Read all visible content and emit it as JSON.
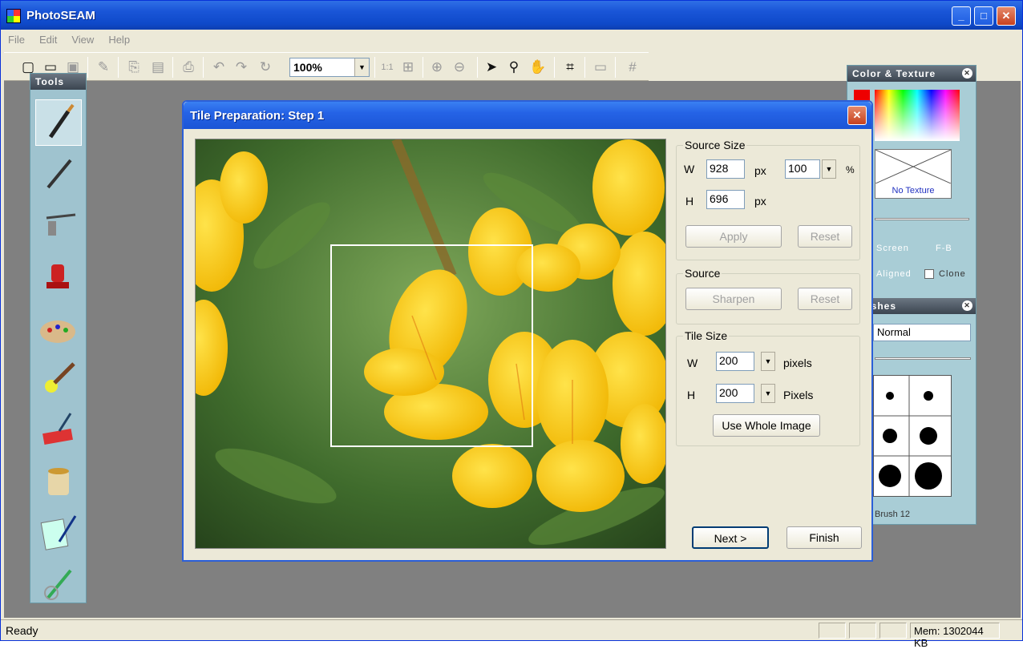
{
  "app": {
    "title": "PhotoSEAM"
  },
  "window_controls": {
    "minimize": "_",
    "maximize": "□",
    "close": "✕"
  },
  "menu": [
    {
      "label": "File"
    },
    {
      "label": "Edit"
    },
    {
      "label": "View"
    },
    {
      "label": "Help"
    }
  ],
  "toolbar": {
    "zoom_value": "100%",
    "actual_size": "1:1"
  },
  "tools_panel": {
    "title": "Tools"
  },
  "color_panel": {
    "title": "Color & Texture",
    "texture_label": "No Texture",
    "screen_label": "Screen",
    "fb_label": "F-B",
    "aligned_label": "Aligned",
    "clone_label": "Clone"
  },
  "brush_panel": {
    "title": "Brushes",
    "blend_mode": "Normal",
    "brush_name": "Brush 12"
  },
  "dialog": {
    "title": "Tile Preparation: Step 1",
    "source_size": {
      "legend": "Source Size",
      "w_label": "W",
      "w_value": "928",
      "w_unit": "px",
      "h_label": "H",
      "h_value": "696",
      "h_unit": "px",
      "percent_value": "100",
      "percent_unit": "%",
      "apply": "Apply",
      "reset": "Reset"
    },
    "source": {
      "legend": "Source",
      "sharpen": "Sharpen",
      "reset": "Reset"
    },
    "tile_size": {
      "legend": "Tile Size",
      "w_label": "W",
      "w_value": "200",
      "w_unit": "pixels",
      "h_label": "H",
      "h_value": "200",
      "h_unit": "Pixels",
      "use_whole": "Use Whole Image"
    },
    "next": "Next >",
    "finish": "Finish"
  },
  "status": {
    "text": "Ready",
    "memory": "Mem: 1302044 KB"
  }
}
